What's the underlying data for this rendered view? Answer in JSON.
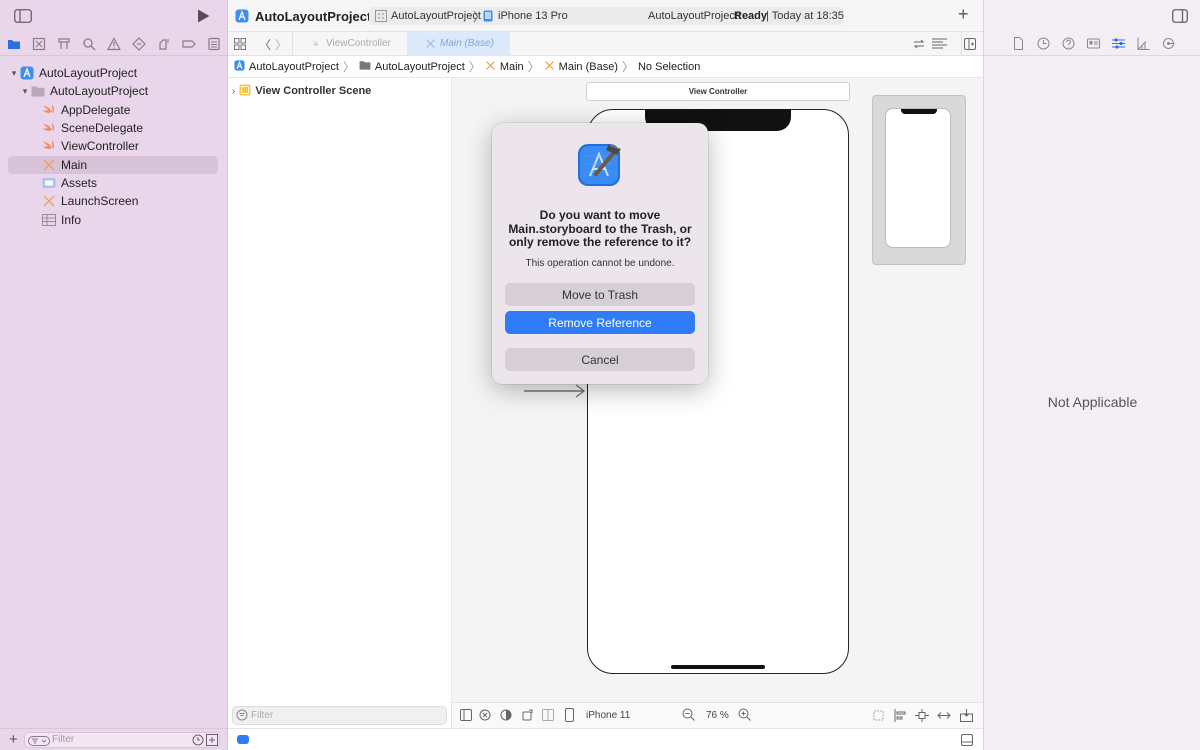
{
  "project_name": "AutoLayoutProject",
  "toolbar": {
    "scheme": "AutoLayoutProject",
    "device": "iPhone 13 Pro",
    "status_project": "AutoLayoutProject:",
    "status_state": "Ready",
    "status_time": "| Today at 18:35"
  },
  "tabs": [
    {
      "label": "ViewController"
    },
    {
      "label": "Main (Base)"
    }
  ],
  "navigator": {
    "items": [
      {
        "label": "AutoLayoutProject"
      },
      {
        "label": "AutoLayoutProject"
      },
      {
        "label": "AppDelegate"
      },
      {
        "label": "SceneDelegate"
      },
      {
        "label": "ViewController"
      },
      {
        "label": "Main"
      },
      {
        "label": "Assets"
      },
      {
        "label": "LaunchScreen"
      },
      {
        "label": "Info"
      }
    ],
    "filter_placeholder": "Filter"
  },
  "jumpbar": {
    "crumbs": [
      "AutoLayoutProject",
      "AutoLayoutProject",
      "Main",
      "Main (Base)",
      "No Selection"
    ]
  },
  "outline": {
    "scene": "View Controller Scene",
    "filter_placeholder": "Filter"
  },
  "canvas": {
    "scene_label": "View Controller",
    "device_config": "iPhone 11",
    "zoom": "76 %"
  },
  "dialog": {
    "message": "Do you want to move Main.storyboard to the Trash, or only remove the reference to it?",
    "info": "This operation cannot be undone.",
    "move_label": "Move to Trash",
    "remove_label": "Remove Reference",
    "cancel_label": "Cancel"
  },
  "inspector": {
    "empty_label": "Not Applicable"
  },
  "colors": {
    "accent": "#2f7cf6",
    "sidebar_bg": "#ead6ea",
    "swift_icon": "#f08a6a",
    "storyboard_icon": "#f0a050"
  }
}
